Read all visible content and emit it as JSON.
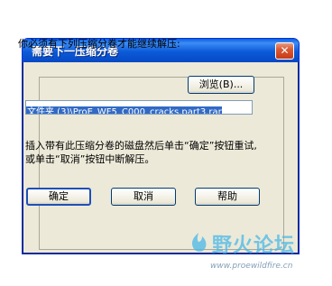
{
  "dialog": {
    "title": "需要下一压缩分卷",
    "close_icon_glyph": "✕",
    "prompt": "你必须有下列压缩分卷才能继续解压:",
    "browse_label": "浏览(B)...",
    "path_value": "文件夹 (3)\\ProE_WF5_C000_cracks.part3.rar",
    "instruction": "插入带有此压缩分卷的磁盘然后单击“确定”按钮重试,或单击“取消”按钮中断解压。",
    "ok_label": "确定",
    "cancel_label": "取消",
    "help_label": "帮助"
  },
  "watermark": {
    "brand": "野火论坛",
    "url": "www.proewildfire.cn"
  },
  "colors": {
    "titlebar": "#0b5bd9",
    "close": "#d95a35",
    "selection": "#316ac5",
    "dialog_bg": "#ece9d8"
  }
}
